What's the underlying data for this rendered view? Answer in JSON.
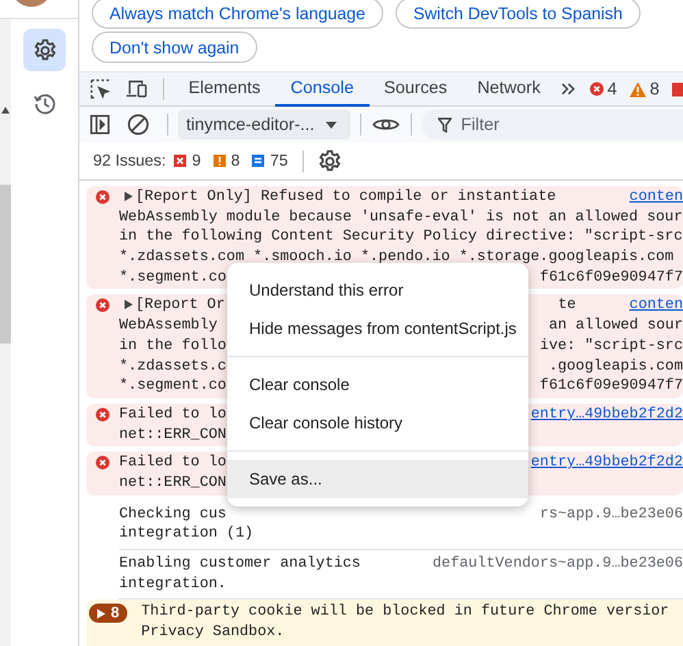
{
  "banner_buttons": [
    {
      "label": "Always match Chrome's language"
    },
    {
      "label": "Switch DevTools to Spanish"
    },
    {
      "label": "Don't show again"
    }
  ],
  "sidebar": {
    "items": [
      {
        "kind": "settings",
        "selected": true
      },
      {
        "kind": "history",
        "selected": false
      }
    ]
  },
  "tabs": [
    {
      "label": "Elements",
      "selected": false
    },
    {
      "label": "Console",
      "selected": true
    },
    {
      "label": "Sources",
      "selected": false
    },
    {
      "label": "Network",
      "selected": false
    }
  ],
  "toolbar_counts": {
    "errors": "4",
    "warnings": "8"
  },
  "context_select": {
    "value": "tinymce-editor-..."
  },
  "filter": {
    "placeholder": "Filter"
  },
  "issues": {
    "label": "92 Issues:",
    "counts": [
      {
        "kind": "error",
        "count": "9"
      },
      {
        "kind": "warning",
        "count": "8"
      },
      {
        "kind": "info",
        "count": "75"
      }
    ]
  },
  "messages": [
    {
      "kind": "error",
      "expanded": false,
      "lines": [
        {
          "text": "[Report Only] Refused to compile or instantiate",
          "right": [
            {
              "kind": "link",
              "text": "conten"
            }
          ]
        },
        {
          "text": "WebAssembly module because 'unsafe-eval' is not an allowed sour"
        },
        {
          "text": "in the following Content Security Policy directive: \"script-src"
        },
        {
          "text": "*.zdassets.com *.smooch.io *.pendo.io *.storage.googleapis.com"
        },
        {
          "text": "*.segment.co",
          "right": [
            {
              "kind": "text",
              "text": "f61c6f09e90947f7"
            }
          ]
        }
      ]
    },
    {
      "kind": "error",
      "expanded": false,
      "lines": [
        {
          "text": "[Report Or",
          "right": [
            {
              "kind": "text",
              "text": "te"
            },
            {
              "kind": "link",
              "text": "conten"
            }
          ]
        },
        {
          "text": "WebAssembly",
          "right": [
            {
              "kind": "text",
              "text": "an allowed sour"
            }
          ]
        },
        {
          "text": "in the follo",
          "right": [
            {
              "kind": "text",
              "text": "ive: \"script-src"
            }
          ]
        },
        {
          "text": "*.zdassets.c",
          "right": [
            {
              "kind": "text",
              "text": ".googleapis.com"
            }
          ]
        },
        {
          "text": "*.segment.co",
          "right": [
            {
              "kind": "text",
              "text": "f61c6f09e90947f7"
            }
          ]
        }
      ]
    },
    {
      "kind": "error",
      "lines": [
        {
          "text": "Failed to lo",
          "right": [
            {
              "kind": "link",
              "text": "entry…49bbeb2f2d2"
            }
          ]
        },
        {
          "text": "net::ERR_CON"
        }
      ]
    },
    {
      "kind": "error",
      "lines": [
        {
          "text": "Failed to lo",
          "right": [
            {
              "kind": "link",
              "text": "entry…49bbeb2f2d2"
            }
          ]
        },
        {
          "text": "net::ERR_CON"
        }
      ]
    },
    {
      "kind": "info",
      "lines": [
        {
          "text": "Checking cus",
          "right": [
            {
              "kind": "source",
              "text": "rs~app.9…be23e06"
            }
          ]
        },
        {
          "text": "integration (1)"
        }
      ]
    },
    {
      "kind": "info",
      "lines": [
        {
          "text": "Enabling customer analytics",
          "right": [
            {
              "kind": "source",
              "text": "defaultVendors~app.9…be23e06"
            }
          ]
        },
        {
          "text": "integration."
        }
      ]
    },
    {
      "kind": "warning_group",
      "expanded": false,
      "count": "8",
      "lines": [
        {
          "text": "Third-party cookie will be blocked in future Chrome versior"
        },
        {
          "text": "Privacy Sandbox."
        }
      ]
    }
  ],
  "context_menu": {
    "groups": [
      {
        "items": [
          {
            "label": "Understand this error",
            "selected": false
          },
          {
            "label": "Hide messages from contentScript.js",
            "selected": false
          }
        ]
      },
      {
        "items": [
          {
            "label": "Clear console",
            "selected": false
          },
          {
            "label": "Clear console history",
            "selected": false
          }
        ]
      },
      {
        "items": [
          {
            "label": "Save as...",
            "selected": true
          }
        ]
      }
    ]
  }
}
